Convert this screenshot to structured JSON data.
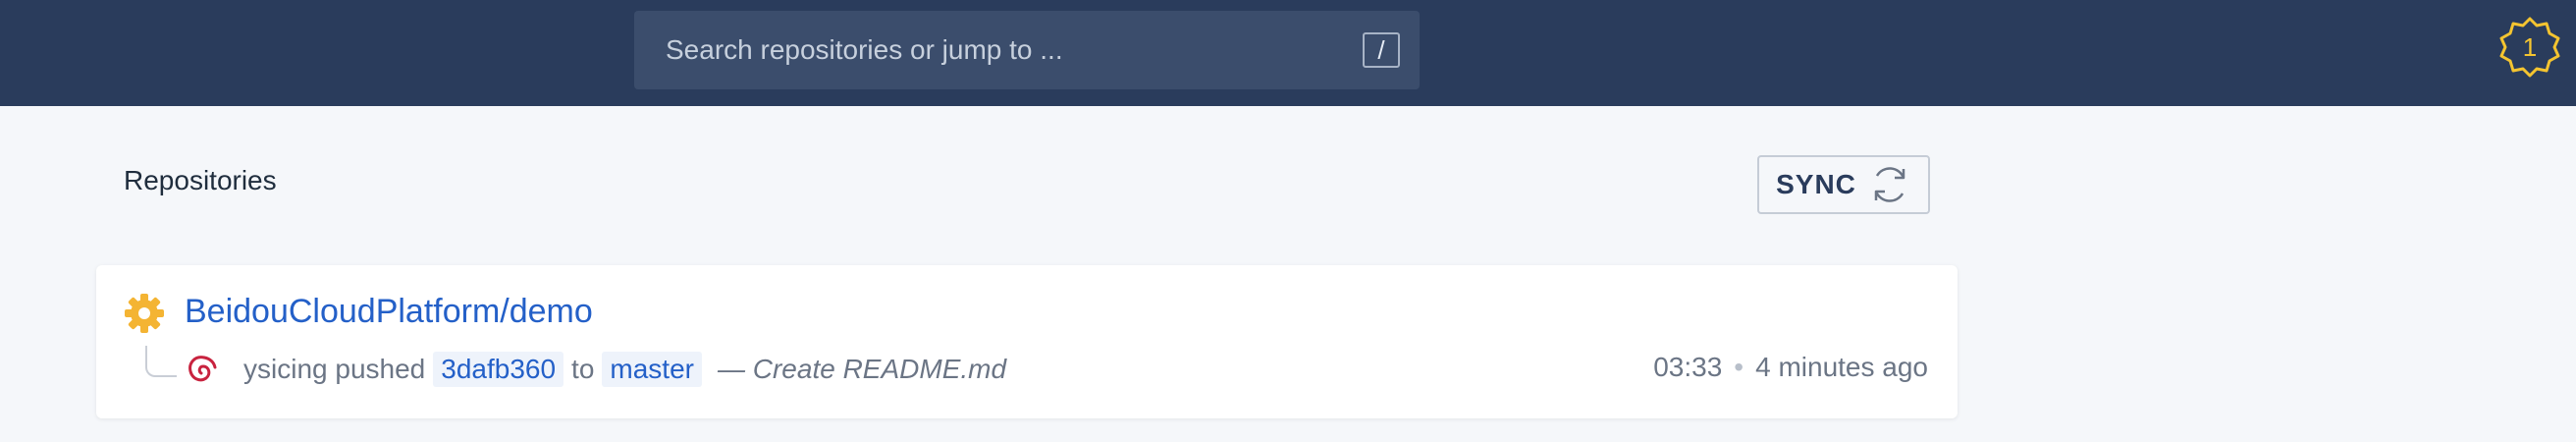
{
  "header": {
    "search": {
      "placeholder": "Search repositories or jump to ...",
      "shortcut": "/"
    },
    "notifications": {
      "count": "1",
      "icon": "notification-badge-icon",
      "color": "#f4c430"
    },
    "background": "#2a3c5c"
  },
  "main": {
    "section_title": "Repositories",
    "sync_button": {
      "label": "SYNC",
      "icon": "refresh-icon"
    }
  },
  "repositories": [
    {
      "name": "BeidouCloudPlatform/demo",
      "icon": "gear-icon",
      "icon_color": "#f4b433",
      "activity": {
        "user": "ysicing",
        "action": "pushed",
        "commit": "3dafb360",
        "connector": "to",
        "branch": "master",
        "message": "— Create README.md",
        "time": "03:33",
        "separator": "•",
        "relative_time": "4 minutes ago"
      }
    }
  ],
  "colors": {
    "link": "#2460c8",
    "muted": "#6b7585",
    "tag_bg": "#eef3fb"
  }
}
